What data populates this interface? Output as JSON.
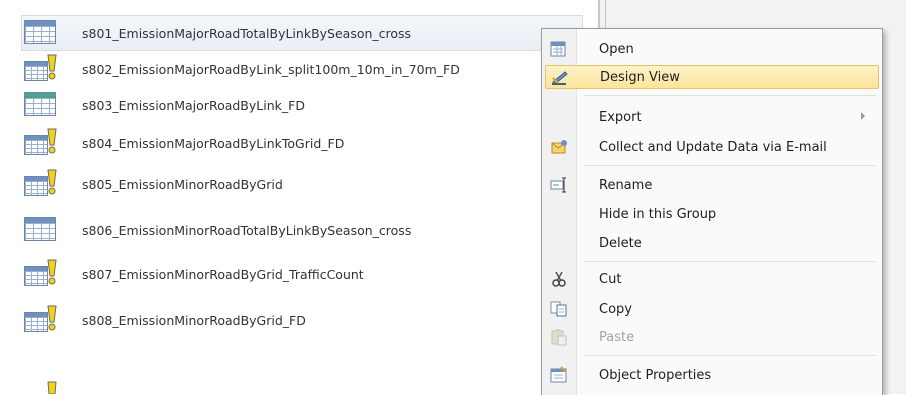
{
  "navigation": {
    "items": [
      {
        "label": "s801_EmissionMajorRoadTotalByLinkBySeason_cross",
        "icon": "crosstab-table-icon"
      },
      {
        "label": "s802_EmissionMajorRoadByLink_split100m_10m_in_70m_FD",
        "icon": "action-query-icon"
      },
      {
        "label": "s803_EmissionMajorRoadByLink_FD",
        "icon": "make-table-icon"
      },
      {
        "label": "s804_EmissionMajorRoadByLinkToGrid_FD",
        "icon": "action-query-icon"
      },
      {
        "label": "s805_EmissionMinorRoadByGrid",
        "icon": "action-query-icon"
      },
      {
        "label": "s806_EmissionMinorRoadTotalByLinkBySeason_cross",
        "icon": "crosstab-table-icon"
      },
      {
        "label": "s807_EmissionMinorRoadByGrid_TrafficCount",
        "icon": "action-query-icon"
      },
      {
        "label": "s808_EmissionMinorRoadByGrid_FD",
        "icon": "action-query-icon"
      }
    ]
  },
  "context_menu": {
    "open": "Open",
    "design_view": "Design View",
    "export": "Export",
    "collect": "Collect and Update Data via E-mail",
    "rename": "Rename",
    "hide": "Hide in this Group",
    "delete": "Delete",
    "cut": "Cut",
    "copy": "Copy",
    "paste": "Paste",
    "properties": "Object Properties"
  },
  "colors": {
    "highlight": "#fbe49a",
    "table_header": "#6f90c2",
    "action_yellow": "#f3d21a"
  }
}
